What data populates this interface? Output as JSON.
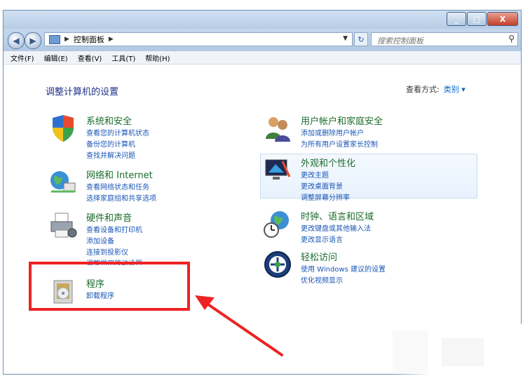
{
  "window": {
    "buttons": {
      "minimize": "_",
      "maximize": "□",
      "close": "X"
    }
  },
  "address": {
    "path": "控制面板",
    "search_placeholder": "搜索控制面板"
  },
  "menu": [
    "文件(F)",
    "编辑(E)",
    "查看(V)",
    "工具(T)",
    "帮助(H)"
  ],
  "page_title": "调整计算机的设置",
  "view_by": {
    "label": "查看方式:",
    "value": "类别 ▾"
  },
  "categories": {
    "system": {
      "title": "系统和安全",
      "links": [
        "查看您的计算机状态",
        "备份您的计算机",
        "查找并解决问题"
      ],
      "icon": "shield-icon"
    },
    "network": {
      "title": "网络和 Internet",
      "links": [
        "查看网络状态和任务",
        "选择家庭组和共享选项"
      ],
      "icon": "network-globe-icon"
    },
    "hardware": {
      "title": "硬件和声音",
      "links": [
        "查看设备和打印机",
        "添加设备",
        "连接到投影仪",
        "调整常用移动设置"
      ],
      "icon": "printer-icon"
    },
    "programs": {
      "title": "程序",
      "links": [
        "卸载程序"
      ],
      "icon": "programs-icon"
    },
    "users": {
      "title": "用户帐户和家庭安全",
      "links": [
        "添加或删除用户帐户",
        "为所有用户设置家长控制"
      ],
      "icon": "users-icon"
    },
    "appearance": {
      "title": "外观和个性化",
      "links": [
        "更改主题",
        "更改桌面背景",
        "调整屏幕分辨率"
      ],
      "icon": "display-icon"
    },
    "clock": {
      "title": "时钟、语言和区域",
      "links": [
        "更改键盘或其他输入法",
        "更改显示语言"
      ],
      "icon": "clock-globe-icon"
    },
    "ease": {
      "title": "轻松访问",
      "links": [
        "使用 Windows 建议的设置",
        "优化视频显示"
      ],
      "icon": "ease-of-access-icon"
    }
  },
  "colors": {
    "annotation": "#ee2323",
    "category_title": "#1a6c2a",
    "link": "#1a56b6"
  }
}
